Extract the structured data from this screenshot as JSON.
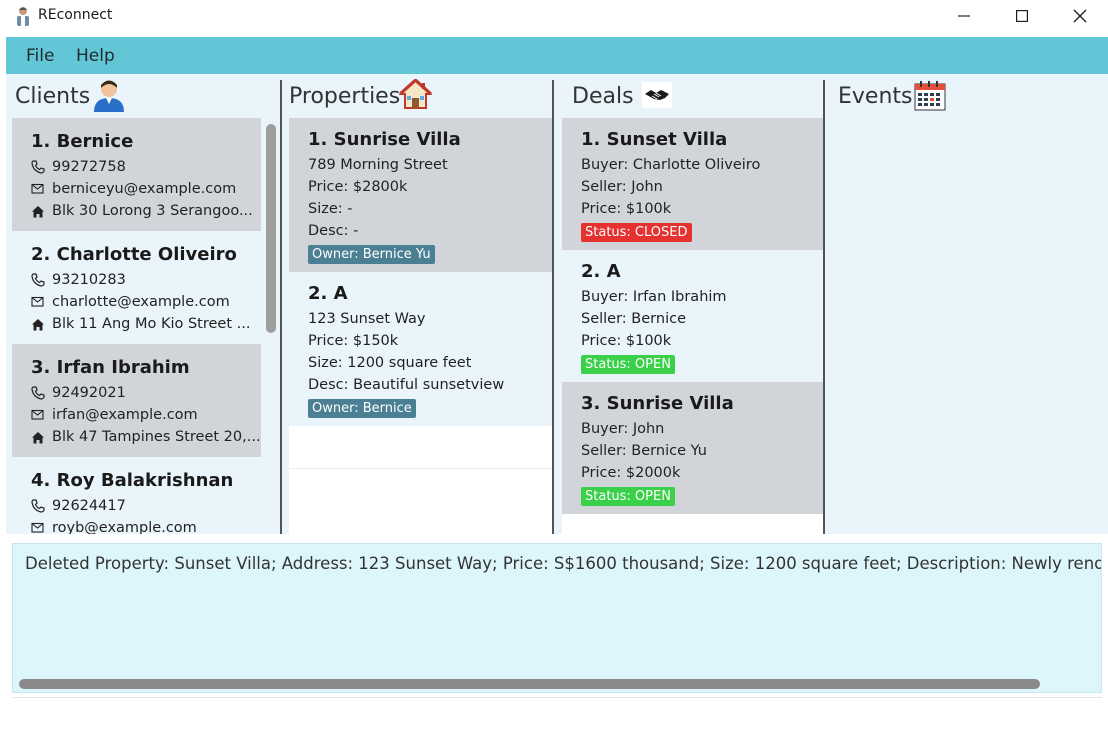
{
  "window": {
    "title": "REconnect"
  },
  "menu": {
    "file": "File",
    "help": "Help"
  },
  "clients": {
    "title": "Clients",
    "items": [
      {
        "name": "1. Bernice",
        "phone": "99272758",
        "email": "berniceyu@example.com",
        "address": "Blk 30 Lorong 3 Serangoo..."
      },
      {
        "name": "2. Charlotte Oliveiro",
        "phone": "93210283",
        "email": "charlotte@example.com",
        "address": "Blk 11 Ang Mo Kio Street ..."
      },
      {
        "name": "3. Irfan Ibrahim",
        "phone": "92492021",
        "email": "irfan@example.com",
        "address": "Blk 47 Tampines Street 20,..."
      },
      {
        "name": "4. Roy Balakrishnan",
        "phone": "92624417",
        "email": "royb@example.com",
        "address": ""
      }
    ]
  },
  "properties": {
    "title": "Properties",
    "items": [
      {
        "name": "1. Sunrise Villa",
        "address": "789 Morning Street",
        "price": "Price: $2800k",
        "size": "Size: -",
        "desc": "Desc: -",
        "owner": "Owner: Bernice Yu"
      },
      {
        "name": "2. A",
        "address": "123 Sunset Way",
        "price": "Price: $150k",
        "size": "Size: 1200 square feet",
        "desc": "Desc: Beautiful sunsetview",
        "owner": "Owner: Bernice"
      }
    ]
  },
  "deals": {
    "title": "Deals",
    "items": [
      {
        "name": "1. Sunset Villa",
        "buyer": "Buyer: Charlotte Oliveiro",
        "seller": "Seller: John",
        "price": "Price: $100k",
        "status": "Status: CLOSED"
      },
      {
        "name": "2. A",
        "buyer": "Buyer: Irfan Ibrahim",
        "seller": "Seller: Bernice",
        "price": "Price: $100k",
        "status": "Status: OPEN"
      },
      {
        "name": "3. Sunrise Villa",
        "buyer": "Buyer: John",
        "seller": "Seller: Bernice Yu",
        "price": "Price: $2000k",
        "status": "Status: OPEN"
      }
    ]
  },
  "events": {
    "title": "Events"
  },
  "result": {
    "text": "Deleted Property: Sunset Villa; Address: 123 Sunset Way; Price: S$1600 thousand; Size: 1200 square feet; Description: Newly renovated; Owner: Bernice Yu"
  },
  "command": {
    "value": ""
  },
  "colors": {
    "menubar": "#62c6d6",
    "closed": "#e5312f",
    "open": "#3bd04a",
    "owner_tag": "#4b7f93"
  }
}
